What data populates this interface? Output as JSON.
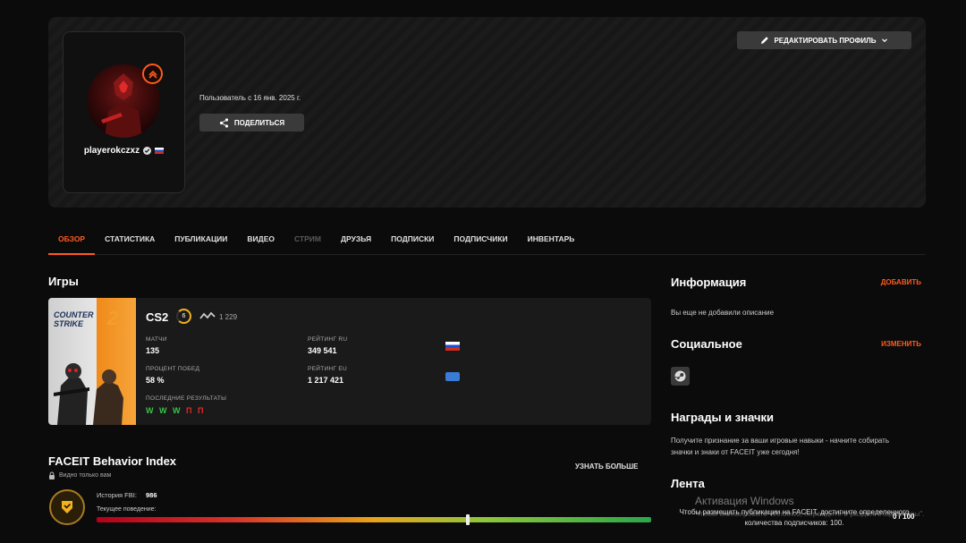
{
  "profile": {
    "username": "playerokczxz",
    "member_since": "Пользователь с 16 янв. 2025 г.",
    "share_label": "ПОДЕЛИТЬСЯ",
    "edit_label": "РЕДАКТИРОВАТЬ ПРОФИЛЬ"
  },
  "tabs": [
    {
      "label": "ОБЗОР",
      "state": "active"
    },
    {
      "label": "СТАТИСТИКА",
      "state": "normal"
    },
    {
      "label": "ПУБЛИКАЦИИ",
      "state": "normal"
    },
    {
      "label": "ВИДЕО",
      "state": "normal"
    },
    {
      "label": "СТРИМ",
      "state": "disabled"
    },
    {
      "label": "ДРУЗЬЯ",
      "state": "normal"
    },
    {
      "label": "ПОДПИСКИ",
      "state": "normal"
    },
    {
      "label": "ПОДПИСЧИКИ",
      "state": "normal"
    },
    {
      "label": "ИНВЕНТАРЬ",
      "state": "normal"
    }
  ],
  "games": {
    "title": "Игры",
    "art_line1": "COUNTER",
    "art_line2": "STRIKE",
    "art_number": "2",
    "game_name": "CS2",
    "level": "6",
    "elo": "1 229",
    "matches_label": "МАТЧИ",
    "matches_value": "135",
    "winrate_label": "ПРОЦЕНТ ПОБЕД",
    "winrate_value": "58 %",
    "recent_label": "ПОСЛЕДНИЕ РЕЗУЛЬТАТЫ",
    "recent_results": [
      "W",
      "W",
      "W",
      "П",
      "П"
    ],
    "rank_ru_label": "РЕЙТИНГ RU",
    "rank_ru_value": "349 541",
    "rank_eu_label": "РЕЙТИНГ EU",
    "rank_eu_value": "1 217 421"
  },
  "fbi": {
    "title": "FACEIT Behavior Index",
    "visibility": "Видно только вам",
    "learn_more": "УЗНАТЬ БОЛЬШЕ",
    "history_label": "История FBI:",
    "history_value": "986",
    "current_label": "Текущее поведение:",
    "current_fraction": 0.67
  },
  "sidebar": {
    "info_title": "Информация",
    "info_action": "ДОБАВИТЬ",
    "info_text": "Вы еще не добавили описание",
    "social_title": "Социальное",
    "social_action": "ИЗМЕНИТЬ",
    "awards_title": "Награды и значки",
    "awards_text": "Получите признание за ваши игровые навыки - начните собирать значки и знаки от FACEIT уже сегодня!",
    "feed_title": "Лента",
    "feed_text": "Чтобы размещать публикации на FACEIT, достигните определенного количества подписчиков: 100.",
    "feed_count": "0 / 100"
  },
  "windows_overlay": {
    "title": "Активация Windows",
    "subtitle": "Чтобы активировать Windows, перейдите в раздел \"Параметры\"."
  },
  "colors": {
    "accent": "#ff5a1f",
    "win": "#3ac24a",
    "loss": "#e22b2b"
  }
}
